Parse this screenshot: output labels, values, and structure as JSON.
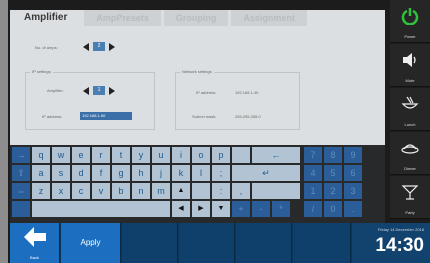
{
  "tabs": [
    "Amplifier",
    "AmpPresets",
    "Grouping",
    "Assignment"
  ],
  "amp_section": {
    "no_of_amps_label": "No. of amps:",
    "no_of_amps_value": "2"
  },
  "ip_settings": {
    "title": "IP settings",
    "amplifier_label": "Amplifier:",
    "amplifier_value": "1",
    "ip_label": "IP address:",
    "ip_value": "192.168.1.60"
  },
  "network_settings": {
    "title": "Network settings",
    "ip_label": "IP address:",
    "ip_value": "192.168.1.40",
    "mask_label": "Subnet mask:",
    "mask_value": "255.255.255.0"
  },
  "keyboard": {
    "row1": [
      "q",
      "w",
      "e",
      "r",
      "t",
      "y",
      "u",
      "i",
      "o",
      "p"
    ],
    "row2": [
      "a",
      "s",
      "d",
      "f",
      "g",
      "h",
      "j",
      "k",
      "l",
      ";"
    ],
    "row3": [
      "z",
      "x",
      "c",
      "v",
      "b",
      "n",
      "m"
    ],
    "num1": [
      "7",
      "8",
      "9"
    ],
    "num2": [
      "4",
      "5",
      "6"
    ],
    "num3": [
      "1",
      "2",
      "3"
    ],
    "num4": [
      "/",
      "0",
      "."
    ],
    "ops": [
      "+",
      "-",
      "*"
    ],
    "tab": "→",
    "shift": "⇧",
    "lang": "⇔",
    "backspace": "←",
    "enter": "↵",
    "up": "▲",
    "left": "◀",
    "right": "▶",
    "down": "▼",
    "colon": ":",
    "comma": ",",
    "dash": "-"
  },
  "side": {
    "power": "Power",
    "mute": "Mute",
    "lunch": "Lunch",
    "dinner": "Dinner",
    "party": "Party"
  },
  "bottom": {
    "back": "Back",
    "apply": "Apply",
    "date": "Friday 14 December 2018",
    "time": "14:30"
  },
  "colors": {
    "power_green": "#2fc13a",
    "accent_blue": "#1b6ec0"
  }
}
